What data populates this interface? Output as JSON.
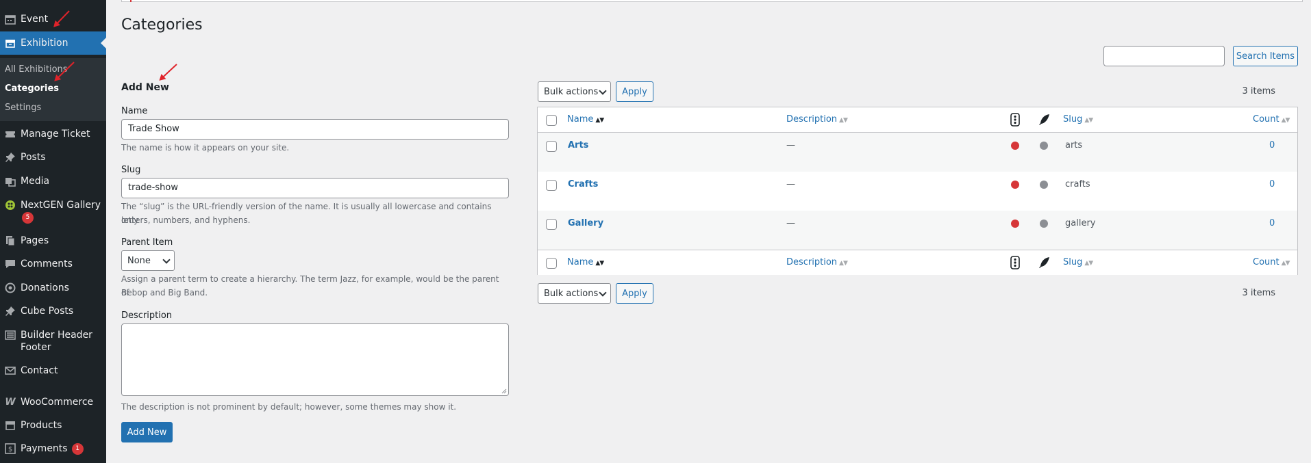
{
  "sidebar": {
    "items": [
      {
        "label": "Event",
        "icon": "calendar-icon"
      },
      {
        "label": "Exhibition",
        "icon": "archive-icon"
      },
      {
        "label": "Manage Ticket",
        "icon": "ticket-icon"
      },
      {
        "label": "Posts",
        "icon": "pin-icon"
      },
      {
        "label": "Media",
        "icon": "media-icon"
      },
      {
        "label": "NextGEN Gallery",
        "icon": "nextgen-icon",
        "badge": "5"
      },
      {
        "label": "Pages",
        "icon": "pages-icon"
      },
      {
        "label": "Comments",
        "icon": "comment-icon"
      },
      {
        "label": "Donations",
        "icon": "donation-icon"
      },
      {
        "label": "Cube Posts",
        "icon": "pin-icon"
      },
      {
        "label": "Builder Header Footer",
        "icon": "builder-icon"
      },
      {
        "label": "Contact",
        "icon": "mail-icon"
      },
      {
        "label": "WooCommerce",
        "icon": "woo-icon"
      },
      {
        "label": "Products",
        "icon": "products-icon"
      },
      {
        "label": "Payments",
        "icon": "payments-icon",
        "badge": "1"
      }
    ],
    "submenu": [
      "All Exhibitions",
      "Categories",
      "Settings"
    ]
  },
  "page": {
    "title": "Categories"
  },
  "search": {
    "value": "",
    "button": "Search Items"
  },
  "form": {
    "heading": "Add New",
    "name_label": "Name",
    "name_value": "Trade Show",
    "name_help": "The name is how it appears on your site.",
    "slug_label": "Slug",
    "slug_value": "trade-show",
    "slug_help_1": "The “slug” is the URL-friendly version of the name. It is usually all lowercase and contains only",
    "slug_help_2": "letters, numbers, and hyphens.",
    "parent_label": "Parent Item",
    "parent_value": "None",
    "parent_help_1": "Assign a parent term to create a hierarchy. The term Jazz, for example, would be the parent of",
    "parent_help_2": "Bebop and Big Band.",
    "desc_label": "Description",
    "desc_help": "The description is not prominent by default; however, some themes may show it.",
    "submit": "Add New"
  },
  "table": {
    "bulk_label": "Bulk actions",
    "apply": "Apply",
    "count": "3 items",
    "columns": {
      "name": "Name",
      "description": "Description",
      "slug": "Slug",
      "count": "Count"
    },
    "rows": [
      {
        "name": "Arts",
        "description": "—",
        "slug": "arts",
        "count": "0"
      },
      {
        "name": "Crafts",
        "description": "—",
        "slug": "crafts",
        "count": "0"
      },
      {
        "name": "Gallery",
        "description": "—",
        "slug": "gallery",
        "count": "0"
      }
    ]
  },
  "colors": {
    "accent": "#2271b1",
    "sidebar": "#1d2327",
    "red": "#d63638"
  }
}
